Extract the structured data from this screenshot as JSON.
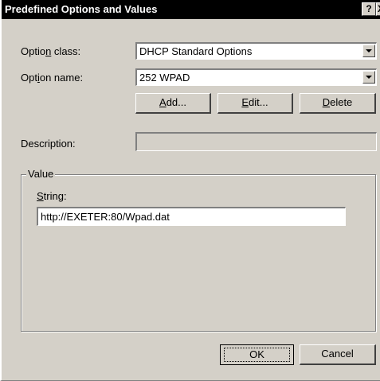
{
  "window": {
    "title": "Predefined Options and Values",
    "help_glyph": "?",
    "close_glyph": "X"
  },
  "option_class": {
    "label_pre": "Optio",
    "label_key": "n",
    "label_post": " class:",
    "value": "DHCP Standard Options"
  },
  "option_name": {
    "label_pre": "Opt",
    "label_key": "i",
    "label_post": "on name:",
    "value": "252 WPAD"
  },
  "buttons": {
    "add_key": "A",
    "add_rest": "dd...",
    "edit_key": "E",
    "edit_rest": "dit...",
    "delete_key": "D",
    "delete_rest": "elete",
    "ok": "OK",
    "cancel": "Cancel"
  },
  "description": {
    "label": "Description:",
    "value": ""
  },
  "value_group": {
    "legend": "Value",
    "string_label_key": "S",
    "string_label_rest": "tring:",
    "string_value": "http://EXETER:80/Wpad.dat"
  },
  "icons": {
    "dropdown": "chevron-down-icon"
  }
}
